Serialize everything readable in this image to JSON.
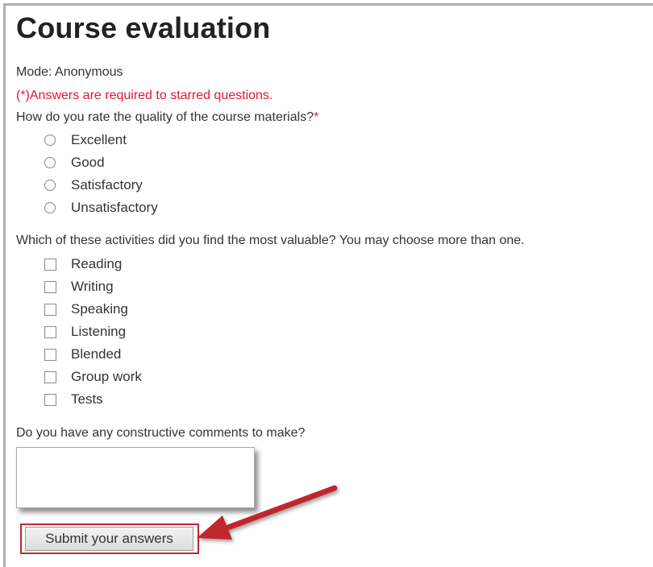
{
  "form": {
    "title": "Course evaluation",
    "mode": "Mode: Anonymous",
    "required_note": "(*)Answers are required to starred questions."
  },
  "question1": {
    "text": "How do you rate the quality of the course materials?",
    "required_marker": "*",
    "options": [
      "Excellent",
      "Good",
      "Satisfactory",
      "Unsatisfactory"
    ]
  },
  "question2": {
    "text": "Which of these activities did you find the most valuable? You may choose more than one.",
    "options": [
      "Reading",
      "Writing",
      "Speaking",
      "Listening",
      "Blended",
      "Group work",
      "Tests"
    ]
  },
  "question3": {
    "text": "Do you have any constructive comments to make?",
    "value": ""
  },
  "submit": {
    "label": "Submit your answers"
  },
  "annotation": {
    "color": "#c1272d"
  }
}
